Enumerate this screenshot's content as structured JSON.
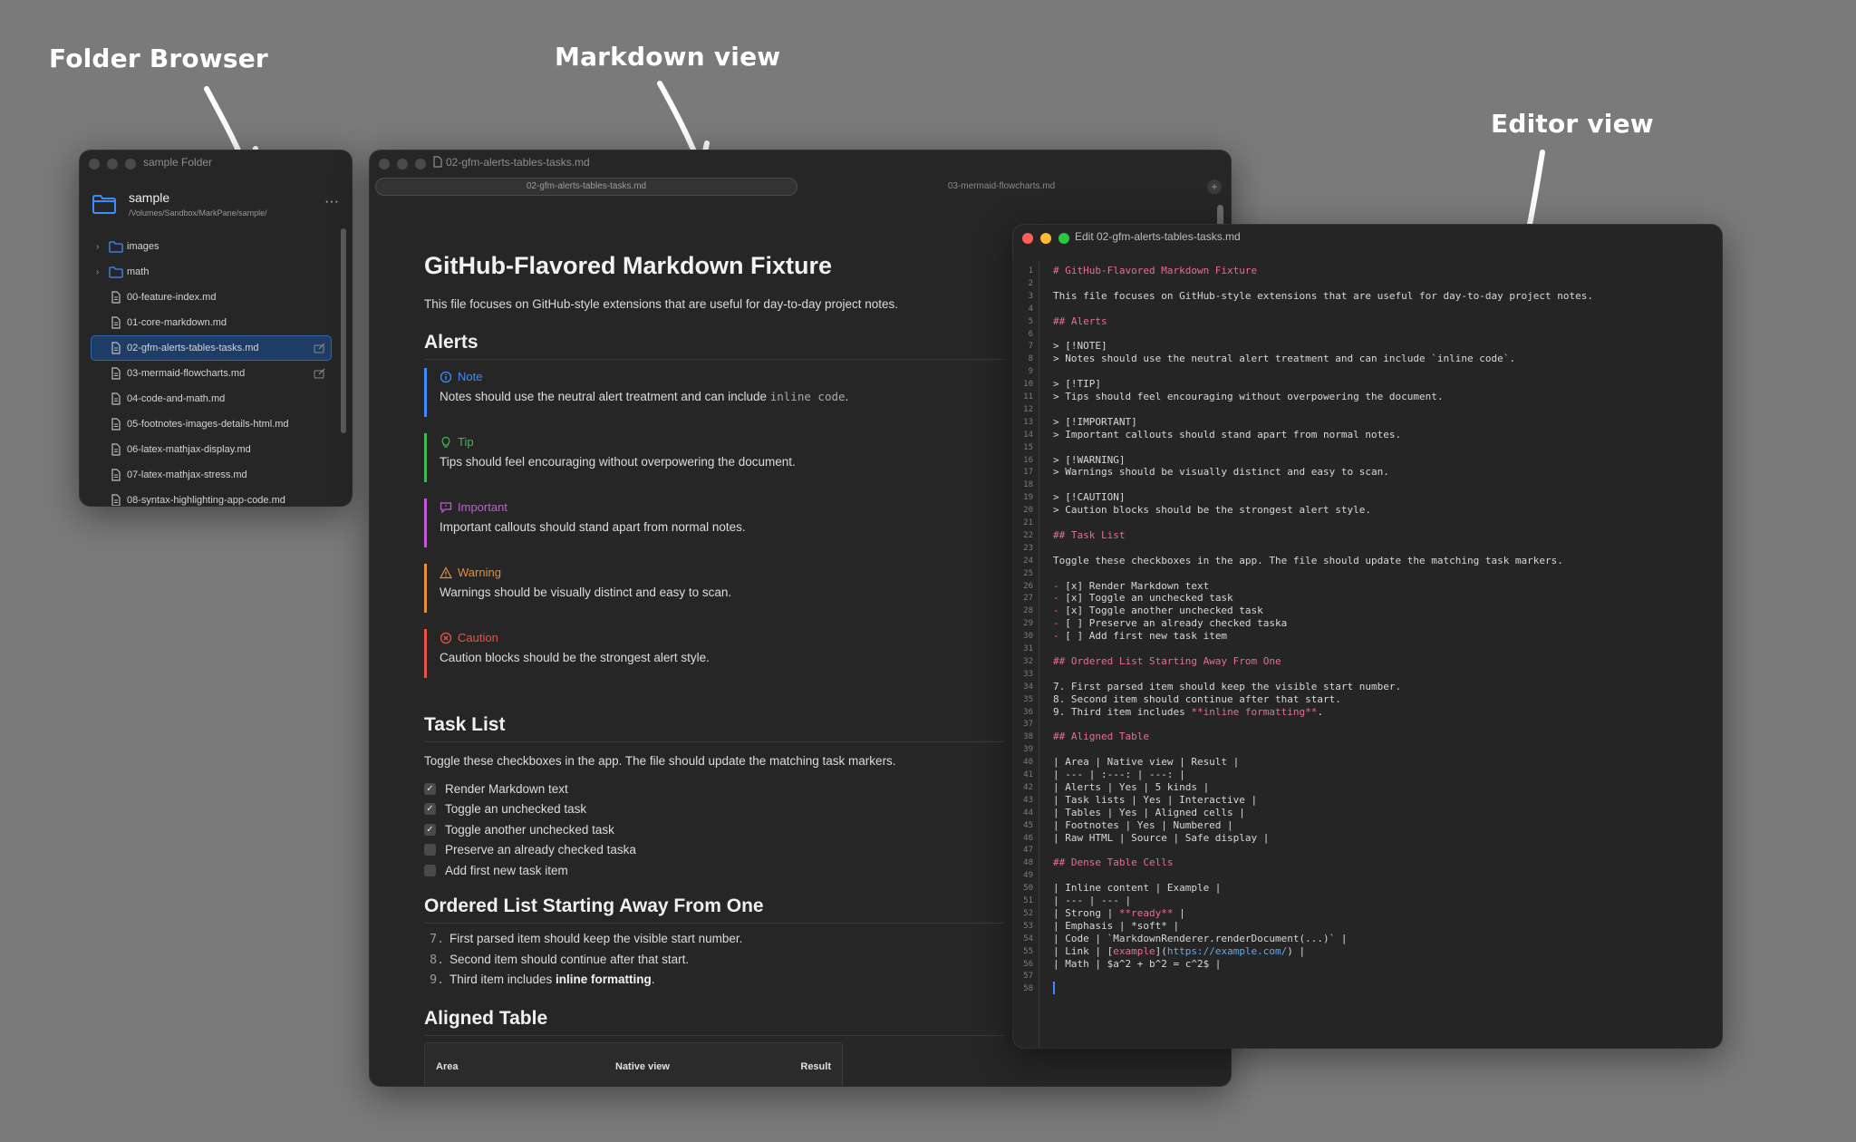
{
  "callouts": {
    "folder_browser": "Folder Browser",
    "markdown_view": "Markdown view",
    "editor_view": "Editor view"
  },
  "folder_window": {
    "title": "sample Folder",
    "folder_name": "sample",
    "folder_path": "/Volumes/Sandbox/MarkPane/sample/",
    "more": "···",
    "items": [
      {
        "label": "images",
        "type": "folder"
      },
      {
        "label": "math",
        "type": "folder"
      },
      {
        "label": "00-feature-index.md",
        "type": "file"
      },
      {
        "label": "01-core-markdown.md",
        "type": "file"
      },
      {
        "label": "02-gfm-alerts-tables-tasks.md",
        "type": "file",
        "selected": true
      },
      {
        "label": "03-mermaid-flowcharts.md",
        "type": "file"
      },
      {
        "label": "04-code-and-math.md",
        "type": "file"
      },
      {
        "label": "05-footnotes-images-details-html.md",
        "type": "file"
      },
      {
        "label": "06-latex-mathjax-display.md",
        "type": "file"
      },
      {
        "label": "07-latex-mathjax-stress.md",
        "type": "file"
      },
      {
        "label": "08-syntax-highlighting-app-code.md",
        "type": "file"
      }
    ]
  },
  "markdown_window": {
    "title": "02-gfm-alerts-tables-tasks.md",
    "tabs": [
      "02-gfm-alerts-tables-tasks.md",
      "03-mermaid-flowcharts.md"
    ],
    "tab_add": "+",
    "h1": "GitHub-Flavored Markdown Fixture",
    "intro": "This file focuses on GitHub-style extensions that are useful for day-to-day project notes.",
    "alerts_heading": "Alerts",
    "alerts": [
      {
        "title": "Note",
        "body": "Notes should use the neutral alert treatment and can include",
        "code": "inline code",
        "tail": ".",
        "color": "#3b8cff",
        "icon": "info-icon"
      },
      {
        "title": "Tip",
        "body": "Tips should feel encouraging without overpowering the document.",
        "color": "#3fb950",
        "icon": "lightbulb-icon"
      },
      {
        "title": "Important",
        "body": "Important callouts should stand apart from normal notes.",
        "color": "#c45ad8",
        "icon": "speech-bubble-icon"
      },
      {
        "title": "Warning",
        "body": "Warnings should be visually distinct and easy to scan.",
        "color": "#e0913a",
        "icon": "warning-triangle-icon"
      },
      {
        "title": "Caution",
        "body": "Caution blocks should be the strongest alert style.",
        "color": "#e5534b",
        "icon": "stop-circle-icon"
      }
    ],
    "task_heading": "Task List",
    "task_intro": "Toggle these checkboxes in the app. The file should update the matching task markers.",
    "tasks": [
      {
        "label": "Render Markdown text",
        "checked": true
      },
      {
        "label": "Toggle an unchecked task",
        "checked": true
      },
      {
        "label": "Toggle another unchecked task",
        "checked": true
      },
      {
        "label": "Preserve an already checked taska",
        "checked": false
      },
      {
        "label": "Add first new task item",
        "checked": false
      }
    ],
    "ordered_heading": "Ordered List Starting Away From One",
    "ordered": [
      {
        "num": "7.",
        "text": "First parsed item should keep the visible start number."
      },
      {
        "num": "8.",
        "text": "Second item should continue after that start."
      },
      {
        "num": "9.",
        "text": "Third item includes ",
        "bold": "inline formatting",
        "tail": "."
      }
    ],
    "table_heading": "Aligned Table",
    "table_headers": [
      "Area",
      "Native view",
      "Result"
    ]
  },
  "editor_window": {
    "title": "Edit 02-gfm-alerts-tables-tasks.md",
    "lines": [
      "# GitHub-Flavored Markdown Fixture",
      "",
      "This file focuses on GitHub-style extensions that are useful for day-to-day project notes.",
      "",
      "## Alerts",
      "",
      "> [!NOTE]",
      "> Notes should use the neutral alert treatment and can include `inline code`.",
      "",
      "> [!TIP]",
      "> Tips should feel encouraging without overpowering the document.",
      "",
      "> [!IMPORTANT]",
      "> Important callouts should stand apart from normal notes.",
      "",
      "> [!WARNING]",
      "> Warnings should be visually distinct and easy to scan.",
      "",
      "> [!CAUTION]",
      "> Caution blocks should be the strongest alert style.",
      "",
      "## Task List",
      "",
      "Toggle these checkboxes in the app. The file should update the matching task markers.",
      "",
      "- [x] Render Markdown text",
      "- [x] Toggle an unchecked task",
      "- [x] Toggle another unchecked task",
      "- [ ] Preserve an already checked taska",
      "- [ ] Add first new task item",
      "",
      "## Ordered List Starting Away From One",
      "",
      "7. First parsed item should keep the visible start number.",
      "8. Second item should continue after that start.",
      "9. Third item includes **inline formatting**.",
      "",
      "## Aligned Table",
      "",
      "| Area | Native view | Result |",
      "| --- | :---: | ---: |",
      "| Alerts | Yes | 5 kinds |",
      "| Task lists | Yes | Interactive |",
      "| Tables | Yes | Aligned cells |",
      "| Footnotes | Yes | Numbered |",
      "| Raw HTML | Source | Safe display |",
      "",
      "## Dense Table Cells",
      "",
      "| Inline content | Example |",
      "| --- | --- |",
      "| Strong | **ready** |",
      "| Emphasis | *soft* |",
      "| Code | `MarkdownRenderer.renderDocument(...)` |",
      "| Link | [example](https://example.com/) |",
      "| Math | $a^2 + b^2 = c^2$ |",
      "",
      ""
    ]
  },
  "colors": {
    "accent": "#3b8cff",
    "heading_pink": "#e86b9a",
    "background": "#7a7a7a"
  }
}
